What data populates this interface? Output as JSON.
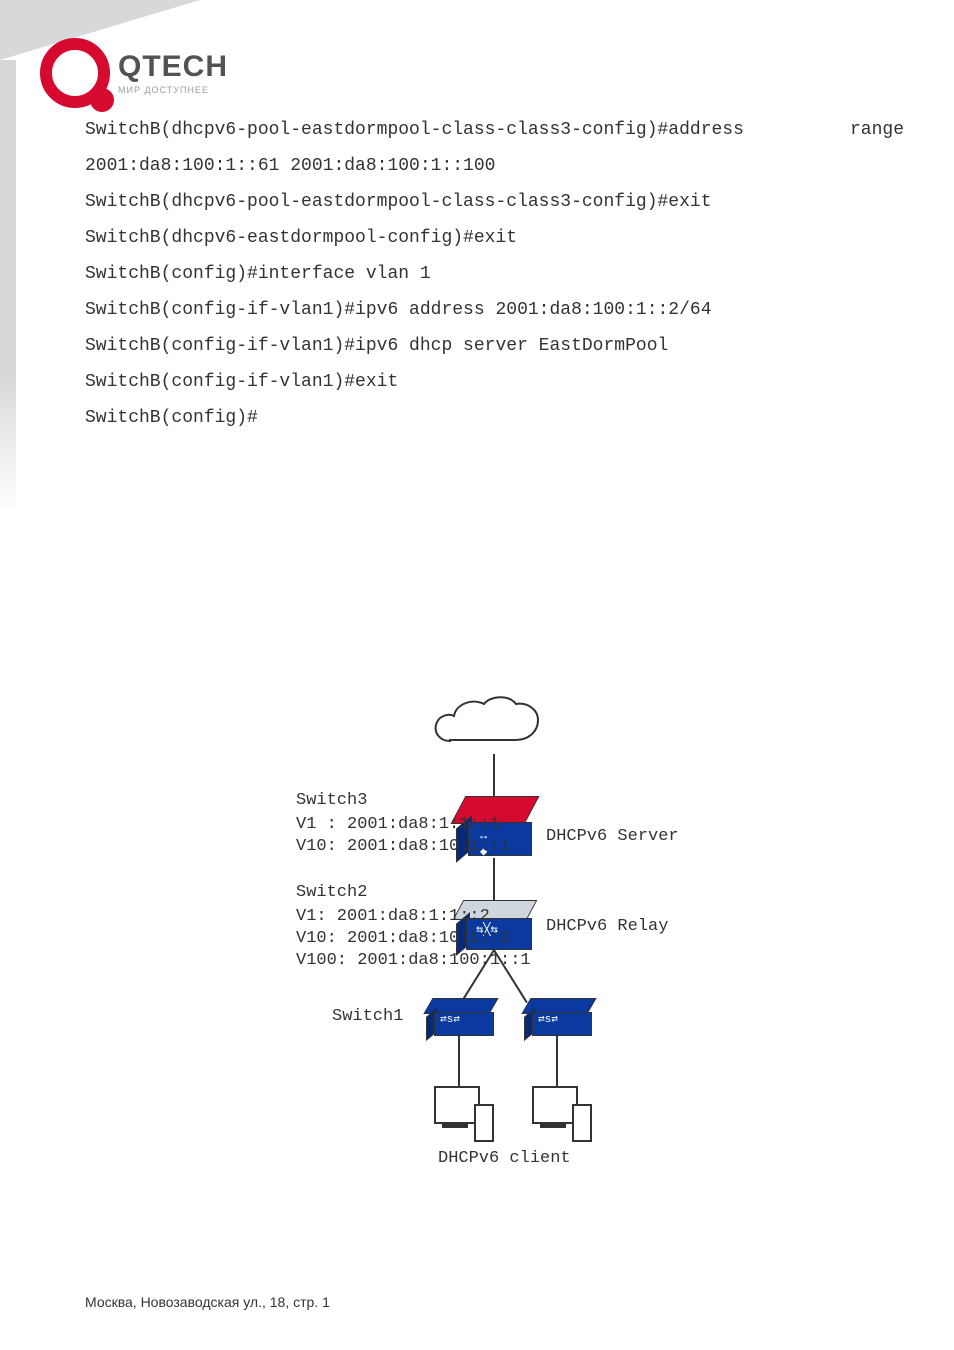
{
  "brand": {
    "name": "QTECH",
    "tagline": "МИР ДОСТУПНЕЕ"
  },
  "code": {
    "0a": "SwitchB(dhcpv6-pool-eastdormpool-class-class3-config)#address",
    "0b": "range",
    "1": "2001:da8:100:1::61 2001:da8:100:1::100",
    "2": "SwitchB(dhcpv6-pool-eastdormpool-class-class3-config)#exit",
    "3": "SwitchB(dhcpv6-eastdormpool-config)#exit",
    "4": "SwitchB(config)#interface vlan 1",
    "5": "SwitchB(config-if-vlan1)#ipv6 address 2001:da8:100:1::2/64",
    "6": "SwitchB(config-if-vlan1)#ipv6 dhcp server EastDormPool",
    "7": "SwitchB(config-if-vlan1)#exit",
    "8": "SwitchB(config)#"
  },
  "diagram": {
    "server_label": "DHCPv6 Server",
    "relay_label": "DHCPv6 Relay",
    "client_label": "DHCPv6 client",
    "switch1": "Switch1",
    "switch3": {
      "title": "Switch3",
      "v1": "V1 : 2001:da8:1:1::1",
      "v10": "V10: 2001:da8:10:1::1"
    },
    "switch2": {
      "title": "Switch2",
      "v1": "V1: 2001:da8:1:1::2",
      "v10": "V10: 2001:da8:10:1::2",
      "v100": "V100: 2001:da8:100:1::1"
    }
  },
  "footer": "Москва, Новозаводская ул., 18, стр. 1"
}
